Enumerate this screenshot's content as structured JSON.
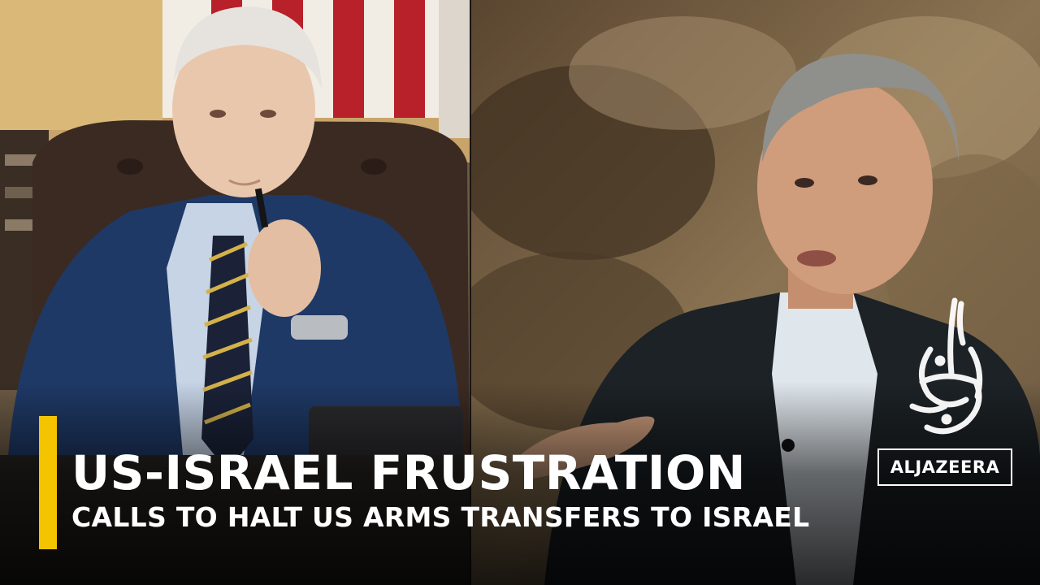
{
  "caption": {
    "headline": "US-ISRAEL FRUSTRATION",
    "subheadline": "CALLS TO HALT US ARMS TRANSFERS TO ISRAEL"
  },
  "branding": {
    "wordmark": "ALJAZEERA",
    "emblem_icon": "al-jazeera-calligraphy-logo"
  },
  "colors": {
    "accent_bar": "#f5c400",
    "caption_text": "#ffffff"
  }
}
